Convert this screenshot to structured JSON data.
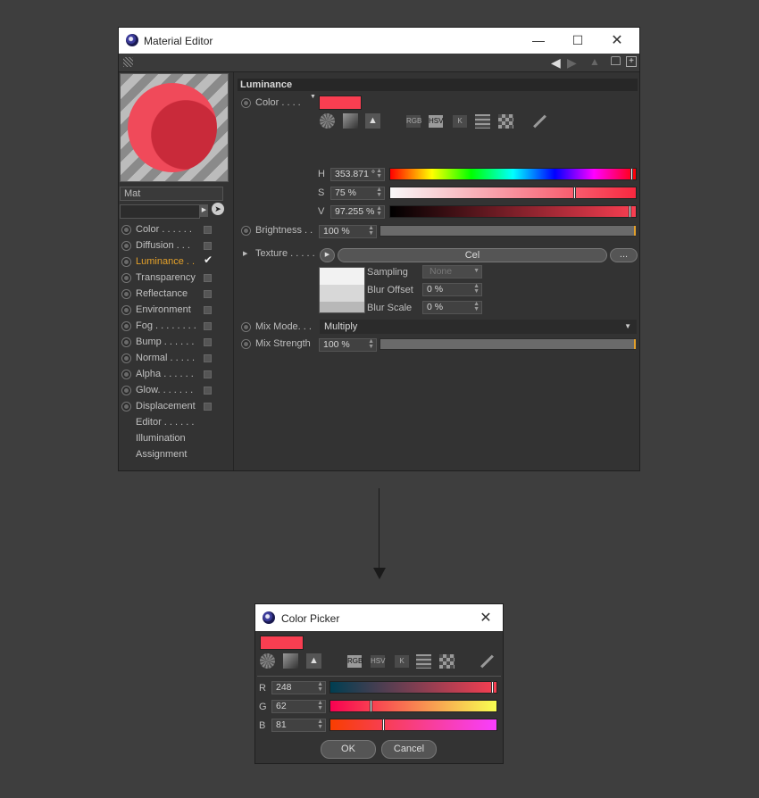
{
  "material_editor": {
    "title": "Material Editor",
    "material_name": "Mat",
    "channels": [
      {
        "label": "Color . . . . . .",
        "checked": false
      },
      {
        "label": "Diffusion . . .",
        "checked": false
      },
      {
        "label": "Luminance . .",
        "checked": true
      },
      {
        "label": "Transparency",
        "checked": false
      },
      {
        "label": "Reflectance",
        "checked": false
      },
      {
        "label": "Environment",
        "checked": false
      },
      {
        "label": "Fog . . . . . . . .",
        "checked": false
      },
      {
        "label": "Bump . . . . . .",
        "checked": false
      },
      {
        "label": "Normal . . . . .",
        "checked": false
      },
      {
        "label": "Alpha . . . . . .",
        "checked": false
      },
      {
        "label": "Glow. . . . . . .",
        "checked": false
      },
      {
        "label": "Displacement",
        "checked": false
      }
    ],
    "extra_items": [
      "Editor . . . . . .",
      "Illumination",
      "Assignment"
    ],
    "section_title": "Luminance",
    "color_label": "Color . . . .",
    "color_swatch": "#f83e51",
    "mode_buttons": [
      "RGB",
      "HSV",
      "K"
    ],
    "h_label": "H",
    "h_value": "353.871 °",
    "s_label": "S",
    "s_value": "75 %",
    "v_label": "V",
    "v_value": "97.255 %",
    "brightness_label": "Brightness . .",
    "brightness_value": "100 %",
    "texture_label": "Texture . . . . .",
    "texture_value": "Cel",
    "texture_more": "...",
    "sampling_label": "Sampling",
    "sampling_value": "None",
    "blur_offset_label": "Blur Offset",
    "blur_offset_value": "0 %",
    "blur_scale_label": "Blur Scale",
    "blur_scale_value": "0 %",
    "mix_mode_label": "Mix Mode. . .",
    "mix_mode_value": "Multiply",
    "mix_strength_label": "Mix Strength",
    "mix_strength_value": "100 %",
    "hsv_levels": {
      "h": 0.983,
      "s": 0.75,
      "v": 0.973
    }
  },
  "color_picker": {
    "title": "Color Picker",
    "swatch": "#f83e51",
    "mode_buttons": [
      "RGB",
      "HSV",
      "K"
    ],
    "r_label": "R",
    "r_value": "248",
    "g_label": "G",
    "g_value": "62",
    "b_label": "B",
    "b_value": "81",
    "ok_label": "OK",
    "cancel_label": "Cancel"
  },
  "colors": {
    "accent": "#e3a02a",
    "active_channel": "#e3a02a",
    "bg": "#3e3e3e"
  }
}
